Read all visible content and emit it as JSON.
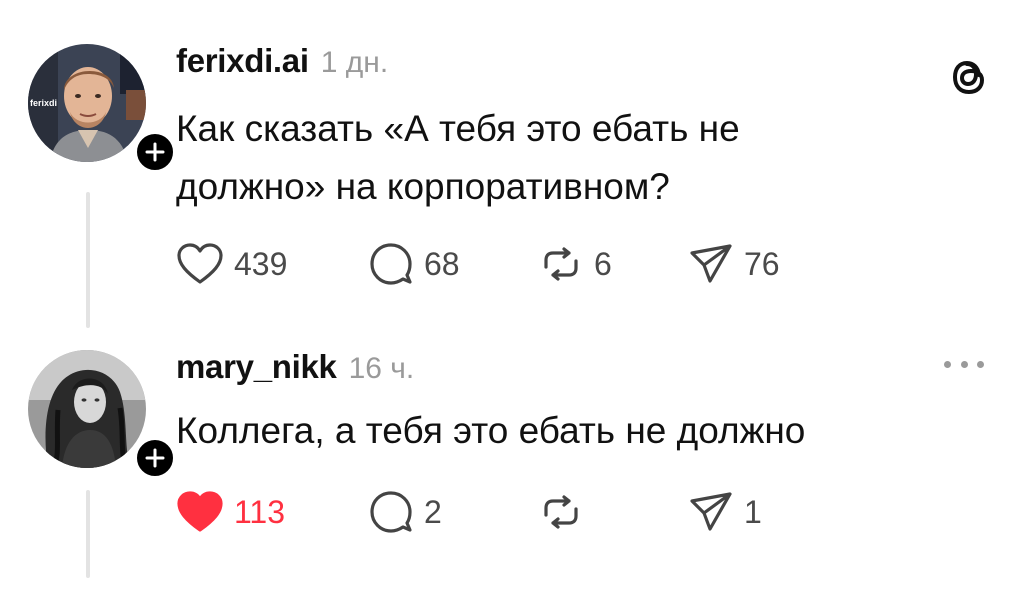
{
  "posts": [
    {
      "username": "ferixdi.ai",
      "time": "1 дн.",
      "text_lines": [
        "Как сказать «А тебя это ебать не",
        "должно» на корпоративном?"
      ],
      "likes": "439",
      "replies": "68",
      "reposts": "6",
      "shares": "76",
      "liked": false,
      "avatar_text": "ferixdi"
    },
    {
      "username": "mary_nikk",
      "time": "16 ч.",
      "text_lines": [
        "Коллега, а тебя это ебать не должно"
      ],
      "likes": "113",
      "replies": "2",
      "reposts": "",
      "shares": "1",
      "liked": true
    }
  ],
  "icons": {
    "brand": "threads-logo-icon",
    "more": "more-options-icon",
    "like": "heart-icon",
    "reply": "comment-icon",
    "repost": "repost-icon",
    "share": "share-icon",
    "follow": "plus-icon"
  },
  "colors": {
    "like_active": "#ff3040",
    "muted": "#9a9a9a",
    "text": "#111111"
  }
}
